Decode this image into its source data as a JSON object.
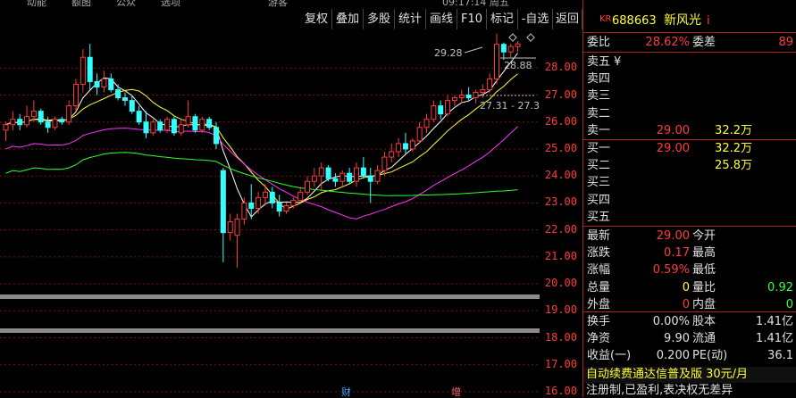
{
  "topcut": [
    "动能",
    "额图",
    "公众",
    "选项",
    "游客",
    "09:17:14 周五"
  ],
  "toolbar": [
    "复权",
    "叠加",
    "多股",
    "统计",
    "画线",
    "F10",
    "标记",
    "-自选",
    "返回"
  ],
  "chart": {
    "ticks": [
      "28.00",
      "27.00",
      "26.00",
      "25.00",
      "24.00",
      "23.00",
      "22.00",
      "21.00",
      "20.00",
      "19.00",
      "18.00",
      "17.00",
      "16.00"
    ],
    "ylim": [
      15.8,
      29.4
    ],
    "annot_high": "29.28",
    "annot_right": "28.88",
    "annot_dash": "27.31 - 27.3",
    "markers": [
      "财",
      "增"
    ],
    "colors": {
      "up": "#ff3b3b",
      "down": "#33ffff",
      "ma5": "#ffffff",
      "ma10": "#ffff33",
      "ma20": "#ff33ff",
      "ma60": "#33ff33"
    },
    "candles": [
      [
        25.7,
        26.0,
        25.3,
        25.9
      ],
      [
        25.9,
        26.4,
        25.7,
        26.1
      ],
      [
        26.1,
        26.3,
        25.7,
        25.9
      ],
      [
        25.9,
        26.6,
        25.8,
        26.2
      ],
      [
        26.2,
        26.8,
        26.0,
        26.4
      ],
      [
        26.4,
        26.5,
        25.9,
        26.0
      ],
      [
        26.0,
        26.2,
        25.6,
        25.8
      ],
      [
        25.8,
        26.2,
        25.7,
        26.1
      ],
      [
        26.1,
        26.2,
        25.9,
        26.0
      ],
      [
        26.0,
        26.8,
        25.9,
        26.6
      ],
      [
        26.6,
        27.6,
        26.4,
        27.4
      ],
      [
        27.4,
        28.7,
        27.1,
        28.4
      ],
      [
        28.4,
        28.9,
        27.2,
        27.5
      ],
      [
        27.5,
        27.8,
        27.0,
        27.3
      ],
      [
        27.3,
        27.9,
        27.1,
        27.6
      ],
      [
        27.6,
        27.8,
        27.1,
        27.2
      ],
      [
        27.2,
        27.4,
        26.8,
        26.9
      ],
      [
        26.9,
        27.1,
        26.6,
        26.8
      ],
      [
        26.8,
        27.0,
        26.3,
        26.4
      ],
      [
        26.4,
        26.6,
        25.9,
        26.0
      ],
      [
        26.0,
        26.4,
        25.4,
        25.6
      ],
      [
        25.6,
        26.1,
        25.5,
        26.0
      ],
      [
        26.0,
        26.1,
        25.6,
        25.7
      ],
      [
        25.7,
        26.2,
        25.6,
        26.1
      ],
      [
        26.1,
        26.2,
        25.5,
        25.6
      ],
      [
        25.6,
        26.1,
        25.5,
        25.9
      ],
      [
        25.9,
        26.8,
        25.8,
        26.2
      ],
      [
        26.2,
        26.3,
        25.6,
        25.7
      ],
      [
        25.7,
        26.2,
        25.6,
        26.1
      ],
      [
        26.1,
        26.2,
        25.7,
        25.8
      ],
      [
        25.8,
        26.0,
        25.0,
        25.2
      ],
      [
        24.2,
        24.3,
        20.8,
        21.9
      ],
      [
        21.9,
        22.6,
        21.6,
        22.3
      ],
      [
        21.8,
        22.6,
        20.6,
        22.4
      ],
      [
        22.4,
        23.2,
        22.2,
        23.0
      ],
      [
        23.0,
        23.7,
        22.4,
        22.8
      ],
      [
        22.8,
        23.4,
        22.6,
        23.2
      ],
      [
        23.2,
        23.7,
        22.9,
        23.4
      ],
      [
        23.4,
        23.6,
        22.8,
        23.0
      ],
      [
        23.0,
        23.3,
        22.5,
        22.7
      ],
      [
        22.7,
        23.0,
        22.6,
        22.9
      ],
      [
        22.9,
        23.2,
        22.8,
        23.1
      ],
      [
        23.1,
        23.6,
        23.0,
        23.4
      ],
      [
        23.4,
        24.0,
        23.3,
        23.8
      ],
      [
        23.8,
        24.3,
        23.6,
        24.0
      ],
      [
        24.0,
        24.5,
        23.5,
        24.3
      ],
      [
        24.3,
        24.4,
        23.8,
        23.9
      ],
      [
        23.9,
        24.1,
        23.6,
        23.8
      ],
      [
        23.8,
        24.2,
        23.6,
        24.1
      ],
      [
        24.1,
        24.3,
        23.7,
        23.8
      ],
      [
        23.8,
        24.5,
        23.6,
        24.3
      ],
      [
        24.3,
        24.7,
        23.9,
        24.0
      ],
      [
        24.0,
        24.3,
        23.0,
        23.8
      ],
      [
        23.8,
        24.4,
        23.7,
        24.2
      ],
      [
        24.2,
        24.9,
        24.0,
        24.7
      ],
      [
        24.7,
        25.2,
        24.5,
        24.9
      ],
      [
        24.9,
        25.4,
        24.7,
        25.2
      ],
      [
        25.2,
        25.6,
        24.8,
        25.0
      ],
      [
        25.0,
        25.4,
        24.9,
        25.3
      ],
      [
        25.3,
        26.0,
        25.2,
        25.8
      ],
      [
        25.8,
        26.3,
        25.6,
        26.1
      ],
      [
        26.1,
        26.8,
        26.0,
        26.6
      ],
      [
        26.6,
        26.8,
        26.1,
        26.3
      ],
      [
        26.3,
        27.0,
        26.2,
        26.8
      ],
      [
        26.8,
        27.0,
        26.6,
        26.9
      ],
      [
        26.9,
        27.2,
        26.7,
        27.0
      ],
      [
        27.0,
        27.3,
        26.8,
        26.9
      ],
      [
        26.9,
        27.2,
        26.7,
        27.1
      ],
      [
        27.1,
        27.4,
        26.9,
        27.2
      ],
      [
        27.2,
        27.8,
        27.1,
        27.6
      ],
      [
        27.6,
        29.28,
        27.4,
        28.88
      ],
      [
        28.88,
        28.95,
        28.3,
        28.6
      ],
      [
        28.6,
        28.9,
        28.4,
        28.8
      ],
      [
        28.8,
        29.0,
        28.6,
        28.9
      ]
    ]
  },
  "panel": {
    "code_prefix": "KR",
    "code": "688663",
    "name": "新风光",
    "info_mark": "i",
    "weibi_label": "委比",
    "weibi_value": "28.62%",
    "weicha_label": "委差",
    "weicha_value": "89",
    "sell": [
      {
        "label": "卖五",
        "price": "",
        "vol": "",
        "extra": "¥"
      },
      {
        "label": "卖四",
        "price": "",
        "vol": ""
      },
      {
        "label": "卖三",
        "price": "",
        "vol": ""
      },
      {
        "label": "卖二",
        "price": "",
        "vol": ""
      },
      {
        "label": "卖一",
        "price": "29.00",
        "vol": "32.2万"
      }
    ],
    "buy": [
      {
        "label": "买一",
        "price": "29.00",
        "vol": "32.2万"
      },
      {
        "label": "买二",
        "price": "",
        "vol": "25.8万"
      },
      {
        "label": "买三",
        "price": "",
        "vol": ""
      },
      {
        "label": "买四",
        "price": "",
        "vol": ""
      },
      {
        "label": "买五",
        "price": "",
        "vol": ""
      }
    ],
    "stats": [
      {
        "l1": "最新",
        "v1": "29.00",
        "c1": "red",
        "l2": "今开",
        "v2": "",
        "c2": "red"
      },
      {
        "l1": "涨跌",
        "v1": "0.17",
        "c1": "red",
        "l2": "最高",
        "v2": "",
        "c2": "red"
      },
      {
        "l1": "涨幅",
        "v1": "0.59%",
        "c1": "red",
        "l2": "最低",
        "v2": "",
        "c2": "red"
      },
      {
        "l1": "总量",
        "v1": "0",
        "c1": "yel",
        "l2": "量比",
        "v2": "0.92",
        "c2": "grn"
      },
      {
        "l1": "外盘",
        "v1": "0",
        "c1": "red",
        "l2": "内盘",
        "v2": "0",
        "c2": "grn"
      }
    ],
    "stats2": [
      {
        "l1": "换手",
        "v1": "0.00%",
        "l2": "股本",
        "v2": "1.41亿"
      },
      {
        "l1": "净资",
        "v1": "9.90",
        "l2": "流通",
        "v2": "1.41亿"
      },
      {
        "l1": "收益(一)",
        "v1": "0.200",
        "l2": "PE(动)",
        "v2": "36.1"
      }
    ],
    "promo": "自动续费通达信普及版  30元/月",
    "promo2": "注册制,已盈利,表决权无差异"
  }
}
